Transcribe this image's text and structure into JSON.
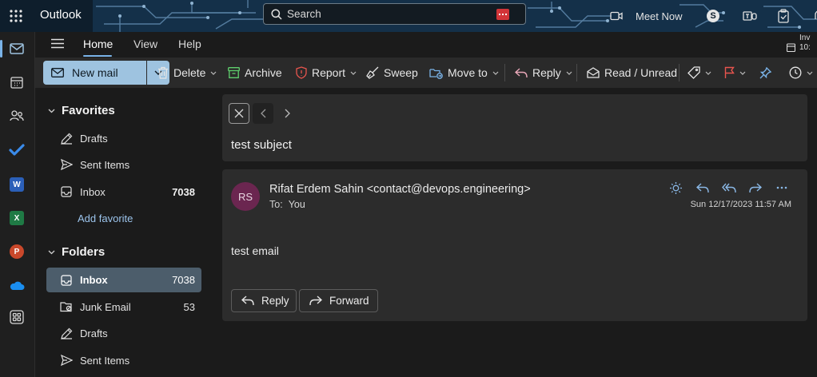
{
  "app": {
    "name": "Outlook"
  },
  "search": {
    "placeholder": "Search"
  },
  "topbar": {
    "meet_now": "Meet Now",
    "overflow_text_top": "Inv",
    "overflow_text_bottom": "10:"
  },
  "tabs": [
    {
      "label": "Home"
    },
    {
      "label": "View"
    },
    {
      "label": "Help"
    }
  ],
  "toolbar": {
    "new_mail": "New mail",
    "delete": "Delete",
    "archive": "Archive",
    "report": "Report",
    "sweep": "Sweep",
    "move_to": "Move to",
    "reply": "Reply",
    "read_unread": "Read / Unread"
  },
  "favorites": {
    "header": "Favorites",
    "items": [
      {
        "label": "Drafts",
        "count": ""
      },
      {
        "label": "Sent Items",
        "count": ""
      },
      {
        "label": "Inbox",
        "count": "7038"
      }
    ],
    "add_favorite": "Add favorite"
  },
  "folders": {
    "header": "Folders",
    "items": [
      {
        "label": "Inbox",
        "count": "7038"
      },
      {
        "label": "Junk Email",
        "count": "53"
      },
      {
        "label": "Drafts",
        "count": ""
      },
      {
        "label": "Sent Items",
        "count": ""
      }
    ]
  },
  "message": {
    "subject": "test subject",
    "avatar_initials": "RS",
    "avatar_color": "#6b2650",
    "sender": "Rifat Erdem Sahin <contact@devops.engineering>",
    "to_label": "To:",
    "to_value": "You",
    "datetime": "Sun 12/17/2023 11:57 AM",
    "body": "test email",
    "reply_label": "Reply",
    "forward_label": "Forward"
  },
  "colors": {
    "accent": "#7ab3e8",
    "new_mail_bg": "#9ec3e0",
    "selected_folder_bg": "#4c5d6b",
    "link": "#9cc4ec"
  }
}
